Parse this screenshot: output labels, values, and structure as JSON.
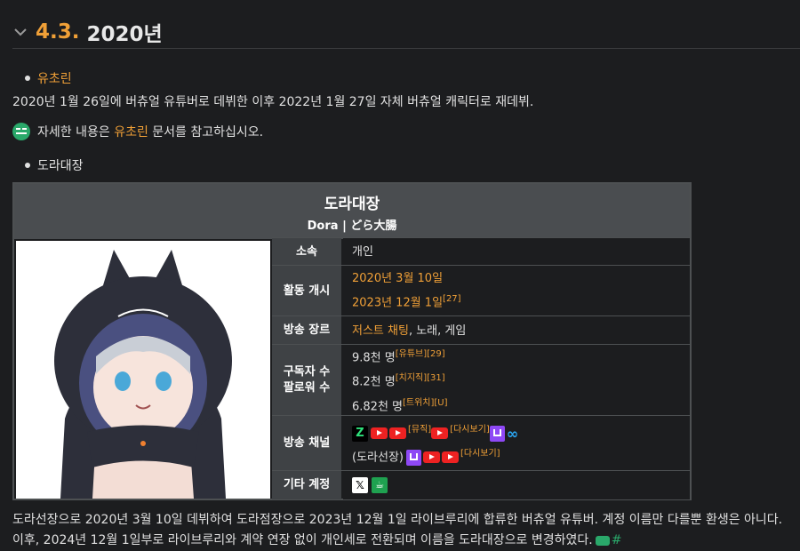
{
  "section": {
    "number": "4.3.",
    "title": "2020년"
  },
  "bullet1": {
    "link": "유초린"
  },
  "para1": "2020년 1월 26일에 버츄얼 유튜버로 데뷔한 이후 2022년 1월 27일 자체 버츄얼 캐릭터로 재데뷔.",
  "note": {
    "prefix": "자세한 내용은 ",
    "link": "유초린",
    "suffix": " 문서를 참고하십시오."
  },
  "bullet2": {
    "text": "도라대장"
  },
  "infobox": {
    "name": "도라대장",
    "subtitle": "Dora | どら大腸",
    "rows": {
      "affiliation": {
        "label": "소속",
        "value": "개인"
      },
      "start": {
        "label": "활동 개시",
        "line1": "2020년 3월 10일",
        "line2": "2023년 12월 1일",
        "line2_ref": "[27]"
      },
      "genre": {
        "label": "방송 장르",
        "link": "저스트 채팅",
        "rest": ", 노래, 게임"
      },
      "subs": {
        "label1": "구독자 수",
        "label2": "팔로워 수",
        "l1": "9.8천 명",
        "l1_ref": "[유튜브][29]",
        "l2": "8.2천 명",
        "l2_ref": "[치지직][31]",
        "l3": "6.82천 명",
        "l3_ref": "[트위치][U]"
      },
      "channels": {
        "label": "방송 채널",
        "ref_music": "[뮤직]",
        "ref_replay1": "[다시보기]",
        "sub_prefix": "(도라선장)",
        "ref_replay2": "[다시보기]"
      },
      "other": {
        "label": "기타 계정"
      }
    }
  },
  "para2": "도라선장으로 2020년 3월 10일 데뷔하여 도라점장으로 2023년 12월 1일 라이브루리에 합류한 버츄얼 유튜버. 계정 이름만 다를뿐 환생은 아니다.",
  "para3": "이후, 2024년 12월 1일부로 라이브루리와 계약 연장 없이 개인세로 전환되며 이름을 도라대장으로 변경하였다.",
  "icons": {
    "chevron": "chevron-down-icon",
    "note": "memo-icon",
    "youtube": "youtube-icon",
    "twitch": "twitch-icon",
    "chzzk": "chzzk-icon",
    "x": "x-icon",
    "kakao": "cup-icon",
    "link": "link-icon"
  },
  "colors": {
    "accent": "#f0a037",
    "bg": "#1c1d1f",
    "header": "#4a4d50",
    "label_bg": "#3f4245"
  }
}
